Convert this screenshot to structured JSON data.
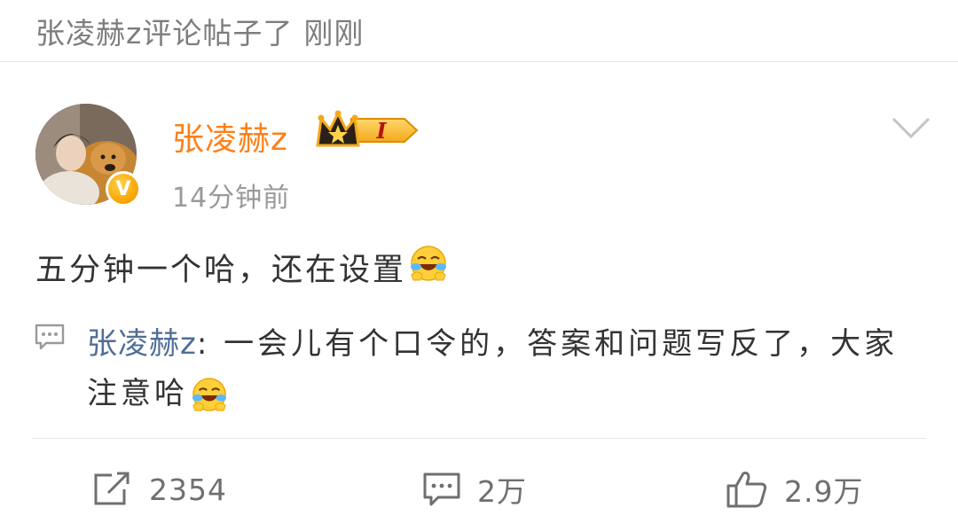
{
  "banner": {
    "message": "张凌赫z评论帖子了",
    "time": "刚刚"
  },
  "post": {
    "author": "张凌赫z",
    "vip_level": "I",
    "time": "14分钟前",
    "content": "五分钟一个哈，还在设置",
    "verified_mark": "V"
  },
  "comment": {
    "author": "张凌赫z",
    "separator": ":",
    "text": " 一会儿有个口令的，答案和问题写反了，大家注意哈"
  },
  "actions": {
    "repost_count": "2354",
    "comment_count": "2万",
    "like_count": "2.9万"
  },
  "colors": {
    "username": "#ff7f16",
    "comment_author": "#4f6d96",
    "muted": "#9a9a9a"
  },
  "icons": {
    "emoji": "laugh-cry-emoji-icon",
    "chevron": "chevron-down-icon",
    "comment": "comment-icon",
    "repost": "repost-icon",
    "like": "thumbs-up-icon",
    "vip": "crown-vip-icon"
  }
}
